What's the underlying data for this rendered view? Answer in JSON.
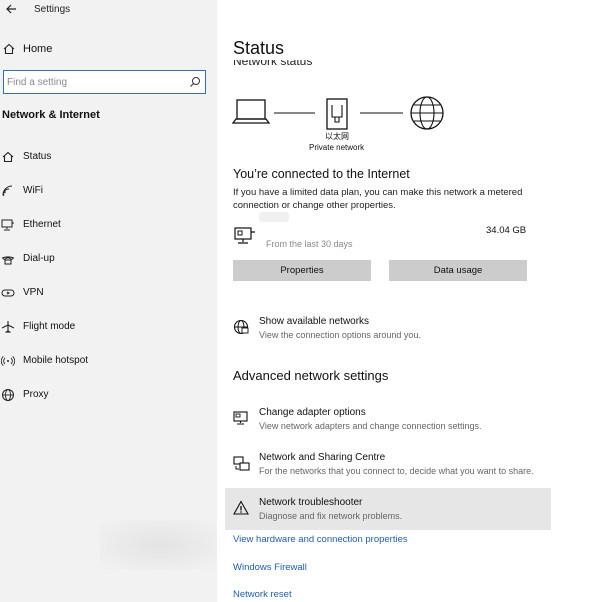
{
  "window": {
    "title": "Settings"
  },
  "sidebar": {
    "home_label": "Home",
    "search_placeholder": "Find a setting",
    "section_title": "Network & Internet",
    "items": [
      {
        "label": "Status",
        "icon": "home-status-icon"
      },
      {
        "label": "WiFi",
        "icon": "wifi-icon"
      },
      {
        "label": "Ethernet",
        "icon": "ethernet-icon"
      },
      {
        "label": "Dial-up",
        "icon": "dial-up-icon"
      },
      {
        "label": "VPN",
        "icon": "vpn-icon"
      },
      {
        "label": "Flight mode",
        "icon": "airplane-icon"
      },
      {
        "label": "Mobile hotspot",
        "icon": "hotspot-icon"
      },
      {
        "label": "Proxy",
        "icon": "globe-icon"
      }
    ]
  },
  "main": {
    "title": "Status",
    "cut_heading": "Network status",
    "diagram": {
      "adapter_label": "以太网",
      "network_label": "Private network"
    },
    "connected_title": "You’re connected to the Internet",
    "connected_desc": "If you have a limited data plan, you can make this network a metered connection or change other properties.",
    "usage": {
      "period": "From the last 30 days",
      "amount": "34.04 GB"
    },
    "buttons": {
      "properties": "Properties",
      "data_usage": "Data usage"
    },
    "show_networks": {
      "title": "Show available networks",
      "desc": "View the connection options around you."
    },
    "advanced_title": "Advanced network settings",
    "advanced_items": [
      {
        "title": "Change adapter options",
        "desc": "View network adapters and change connection settings."
      },
      {
        "title": "Network and Sharing Centre",
        "desc": "For the networks that you connect to, decide what you want to share."
      },
      {
        "title": "Network troubleshooter",
        "desc": "Diagnose and fix network problems."
      }
    ],
    "links": {
      "hardware": "View hardware and connection properties",
      "firewall": "Windows Firewall",
      "reset": "Network reset"
    }
  },
  "colors": {
    "accent": "#2f6fbf",
    "link": "#1a5fb4",
    "sidebar_bg": "#f2f2f2",
    "button_bg": "#cccccc",
    "highlight_bg": "#e6e6e6"
  }
}
